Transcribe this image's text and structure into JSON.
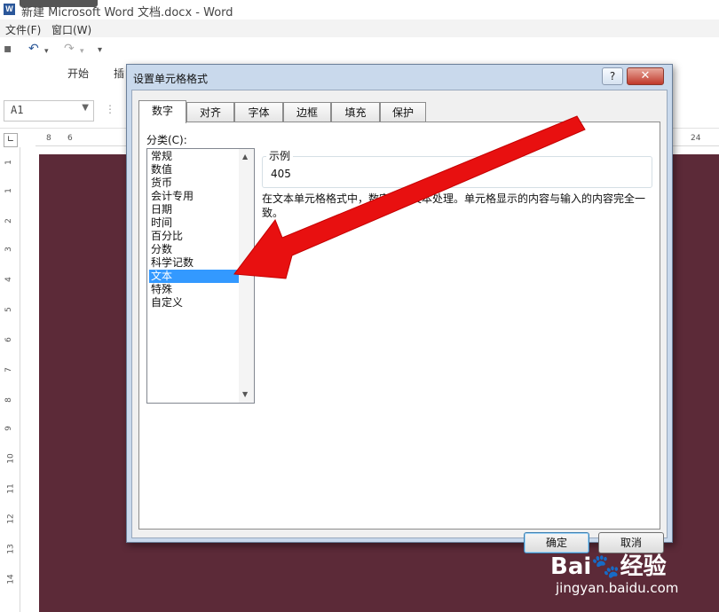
{
  "window": {
    "title": "新建 Microsoft Word 文档.docx - Word",
    "icon": "word-app-icon"
  },
  "menubar": {
    "items": [
      "文件(F)",
      "窗口(W)"
    ]
  },
  "quick_access": {
    "icons": [
      "save-icon",
      "undo-icon",
      "redo-icon",
      "customize-icon"
    ]
  },
  "ribbon": {
    "tabs": [
      "开始",
      "插"
    ]
  },
  "name_box": {
    "value": "A1"
  },
  "ruler": {
    "h_left": [
      "8",
      "6"
    ],
    "h_right": "24",
    "v_numbers": [
      "1",
      "1",
      "2",
      "3",
      "4",
      "5",
      "6",
      "7",
      "8",
      "9",
      "10",
      "11",
      "12",
      "13",
      "14",
      "15"
    ]
  },
  "dialog": {
    "title": "设置单元格格式",
    "help_label": "?",
    "close_label": "✕",
    "tabs": [
      "数字",
      "对齐",
      "字体",
      "边框",
      "填充",
      "保护"
    ],
    "active_tab": "数字",
    "category_label": "分类(C):",
    "categories": [
      "常规",
      "数值",
      "货币",
      "会计专用",
      "日期",
      "时间",
      "百分比",
      "分数",
      "科学记数",
      "文本",
      "特殊",
      "自定义"
    ],
    "selected_category": "文本",
    "sample_label": "示例",
    "sample_value": "405",
    "description": "在文本单元格格式中，数字作为文本处理。单元格显示的内容与输入的内容完全一致。",
    "ok_label": "确定",
    "cancel_label": "取消"
  },
  "watermark": {
    "logo": "Bai🐾经验",
    "url": "jingyan.baidu.com"
  },
  "colors": {
    "doc_bg": "#5c2a38",
    "selection": "#3399ff",
    "arrow": "#e81010"
  }
}
